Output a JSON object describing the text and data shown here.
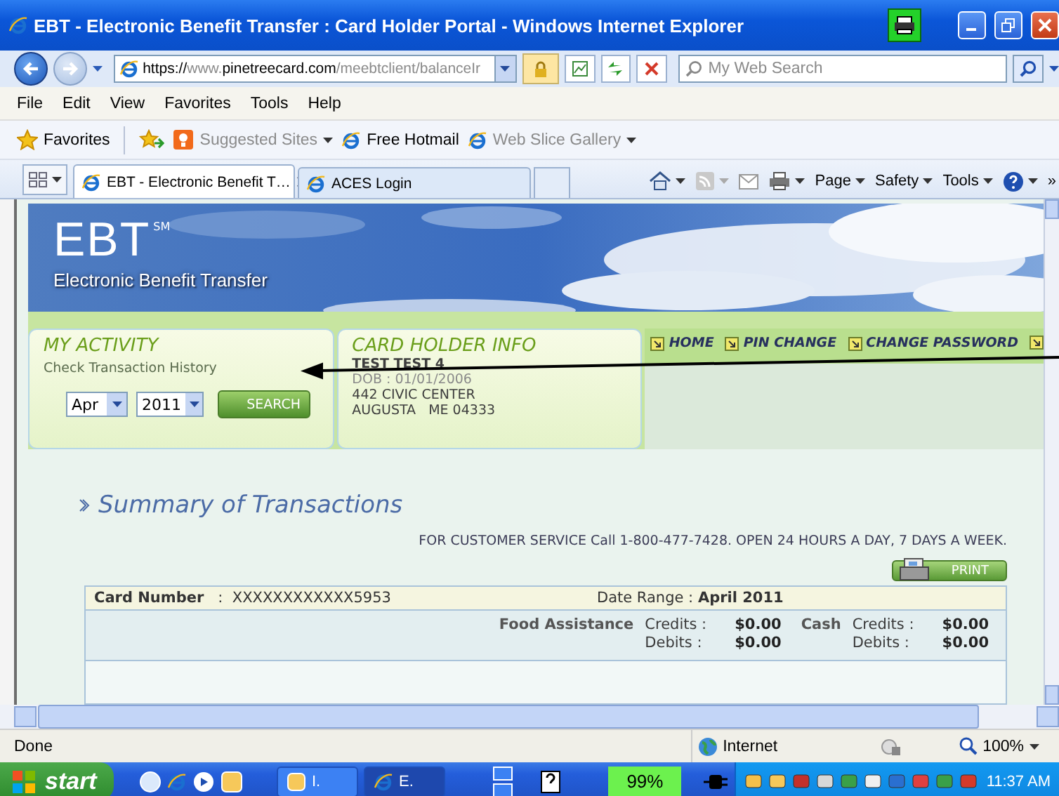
{
  "window": {
    "title": "EBT - Electronic Benefit Transfer : Card Holder Portal - Windows Internet Explorer"
  },
  "address_bar": {
    "segments": [
      {
        "text": "https://",
        "dim": false
      },
      {
        "text": "www.",
        "dim": true
      },
      {
        "text": "pinetreecard.com",
        "dim": false
      },
      {
        "text": "/meebtclient/balanceIr",
        "dim": true
      }
    ]
  },
  "search": {
    "placeholder": "My Web Search"
  },
  "menu": [
    "File",
    "Edit",
    "View",
    "Favorites",
    "Tools",
    "Help"
  ],
  "favorites_bar": {
    "label": "Favorites",
    "links": [
      {
        "label": "Suggested Sites",
        "dim": true,
        "dropdown": true
      },
      {
        "label": "Free Hotmail",
        "dim": false,
        "dropdown": false
      },
      {
        "label": "Web Slice Gallery",
        "dim": true,
        "dropdown": true
      }
    ]
  },
  "tabs": [
    {
      "label": "EBT - Electronic Benefit T…",
      "selected": true
    },
    {
      "label": "ACES Login",
      "selected": false
    }
  ],
  "command_bar": {
    "menus": [
      "Page",
      "Safety",
      "Tools"
    ],
    "overflow": "»"
  },
  "page": {
    "logo": "EBT",
    "logo_mark": "SM",
    "tagline": "Electronic Benefit Transfer",
    "activity": {
      "title": "MY ACTIVITY",
      "subtitle": "Check Transaction History",
      "month": "Apr",
      "year": "2011",
      "button": "SEARCH"
    },
    "card_holder": {
      "title": "CARD HOLDER INFO",
      "lines": [
        "TEST TEST 4",
        "DOB : 01/01/2006",
        "442 CIVIC CENTER",
        "AUGUSTA   ME 04333"
      ]
    },
    "nav_links": [
      "HOME",
      "PIN CHANGE",
      "CHANGE PASSWORD"
    ],
    "summary_title": "Summary of Transactions",
    "service_notice": "FOR CUSTOMER SERVICE Call 1-800-477-7428. OPEN 24 HOURS A DAY, 7 DAYS A WEEK.",
    "print_button": "PRINT",
    "card_number": "**Card Number**   :  XXXXXXXXXXXX5953",
    "date_range": "Date Range : **April 2011**",
    "benefits": [
      {
        "name": "Food Assistance",
        "credits_label": "Credits :",
        "credits": "$0.00",
        "debits_label": "Debits :",
        "debits": "$0.00"
      },
      {
        "name": "Cash",
        "credits_label": "Credits :",
        "credits": "$0.00",
        "debits_label": "Debits :",
        "debits": "$0.00"
      }
    ]
  },
  "status_bar": {
    "text": "Done",
    "zone": "Internet",
    "zoom": "100%"
  },
  "taskbar": {
    "start": "start",
    "tasks": [
      {
        "label": "I.",
        "selected": false
      },
      {
        "label": "E.",
        "selected": true
      }
    ],
    "battery": "99%",
    "clock": "11:37 AM"
  }
}
